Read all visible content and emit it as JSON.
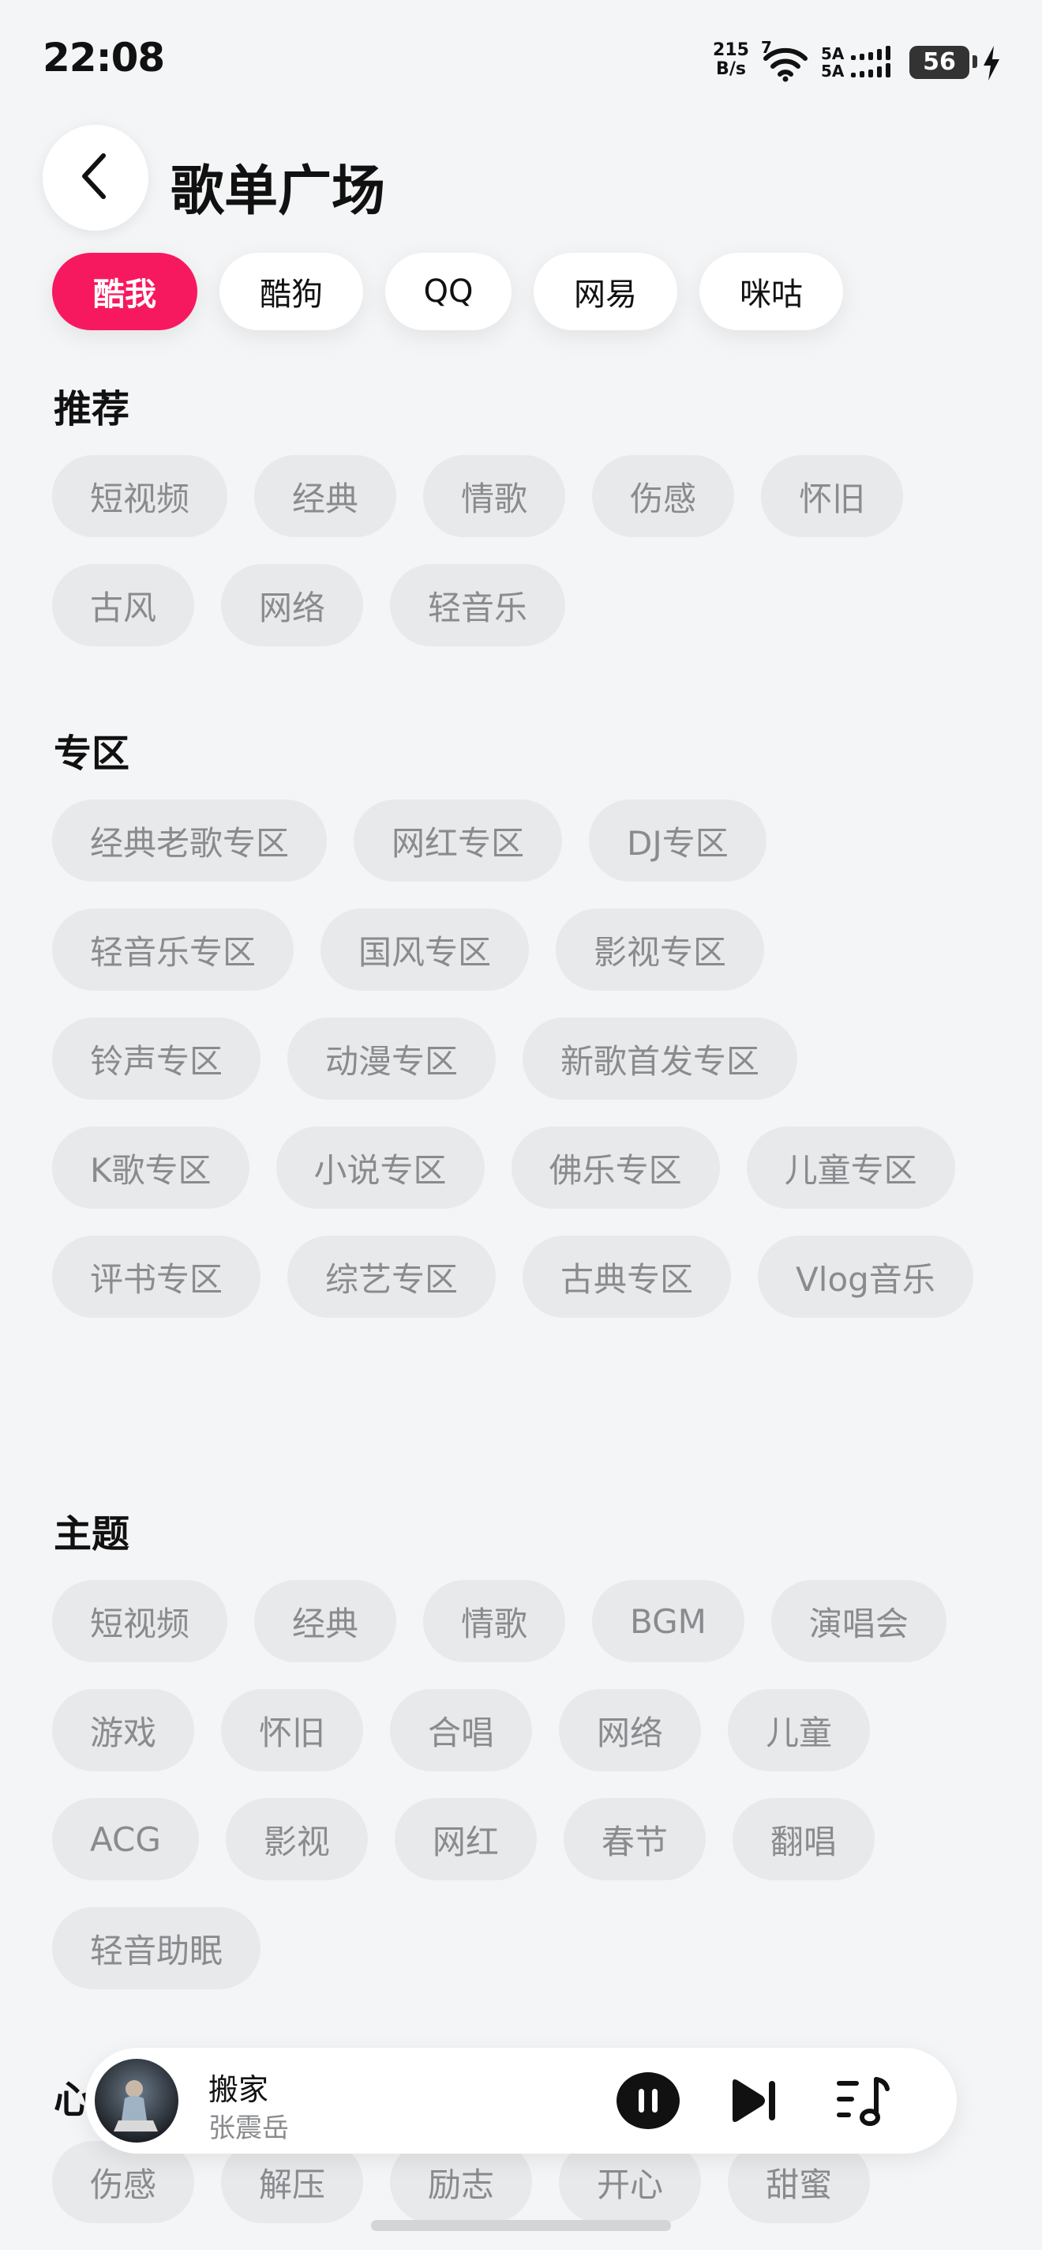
{
  "status_bar": {
    "time": "22:08",
    "net_speed_value": "215",
    "net_speed_unit": "B/s",
    "wifi_badge": "7",
    "sim1_label": "5A",
    "sim2_label": "5A",
    "battery": "56"
  },
  "header": {
    "title": "歌单广场"
  },
  "tabs": [
    {
      "label": "酷我",
      "active": true
    },
    {
      "label": "酷狗",
      "active": false
    },
    {
      "label": "QQ",
      "active": false
    },
    {
      "label": "网易",
      "active": false
    },
    {
      "label": "咪咕",
      "active": false
    }
  ],
  "sections": [
    {
      "title": "推荐",
      "chips": [
        "短视频",
        "经典",
        "情歌",
        "伤感",
        "怀旧",
        "古风",
        "网络",
        "轻音乐"
      ]
    },
    {
      "title": "专区",
      "chips": [
        "经典老歌专区",
        "网红专区",
        "DJ专区",
        "轻音乐专区",
        "国风专区",
        "影视专区",
        "铃声专区",
        "动漫专区",
        "新歌首发专区",
        "K歌专区",
        "小说专区",
        "佛乐专区",
        "儿童专区",
        "评书专区",
        "综艺专区",
        "古典专区",
        "Vlog音乐"
      ]
    },
    {
      "title": "主题",
      "chips": [
        "短视频",
        "经典",
        "情歌",
        "BGM",
        "演唱会",
        "游戏",
        "怀旧",
        "合唱",
        "网络",
        "儿童",
        "ACG",
        "影视",
        "网红",
        "春节",
        "翻唱",
        "轻音助眠"
      ]
    },
    {
      "title": "心情",
      "chips": [
        "伤感",
        "解压",
        "励志",
        "开心",
        "甜蜜"
      ]
    }
  ],
  "player": {
    "title": "搬家",
    "artist": "张震岳"
  },
  "colors": {
    "accent": "#f7195f",
    "chip_bg": "#e8e9eb",
    "chip_text": "#8a8b8e",
    "page_bg": "#f4f5f7"
  },
  "icons": {
    "back": "chevron-left-icon",
    "pause": "pause-icon",
    "next": "skip-next-icon",
    "queue": "playlist-icon"
  }
}
